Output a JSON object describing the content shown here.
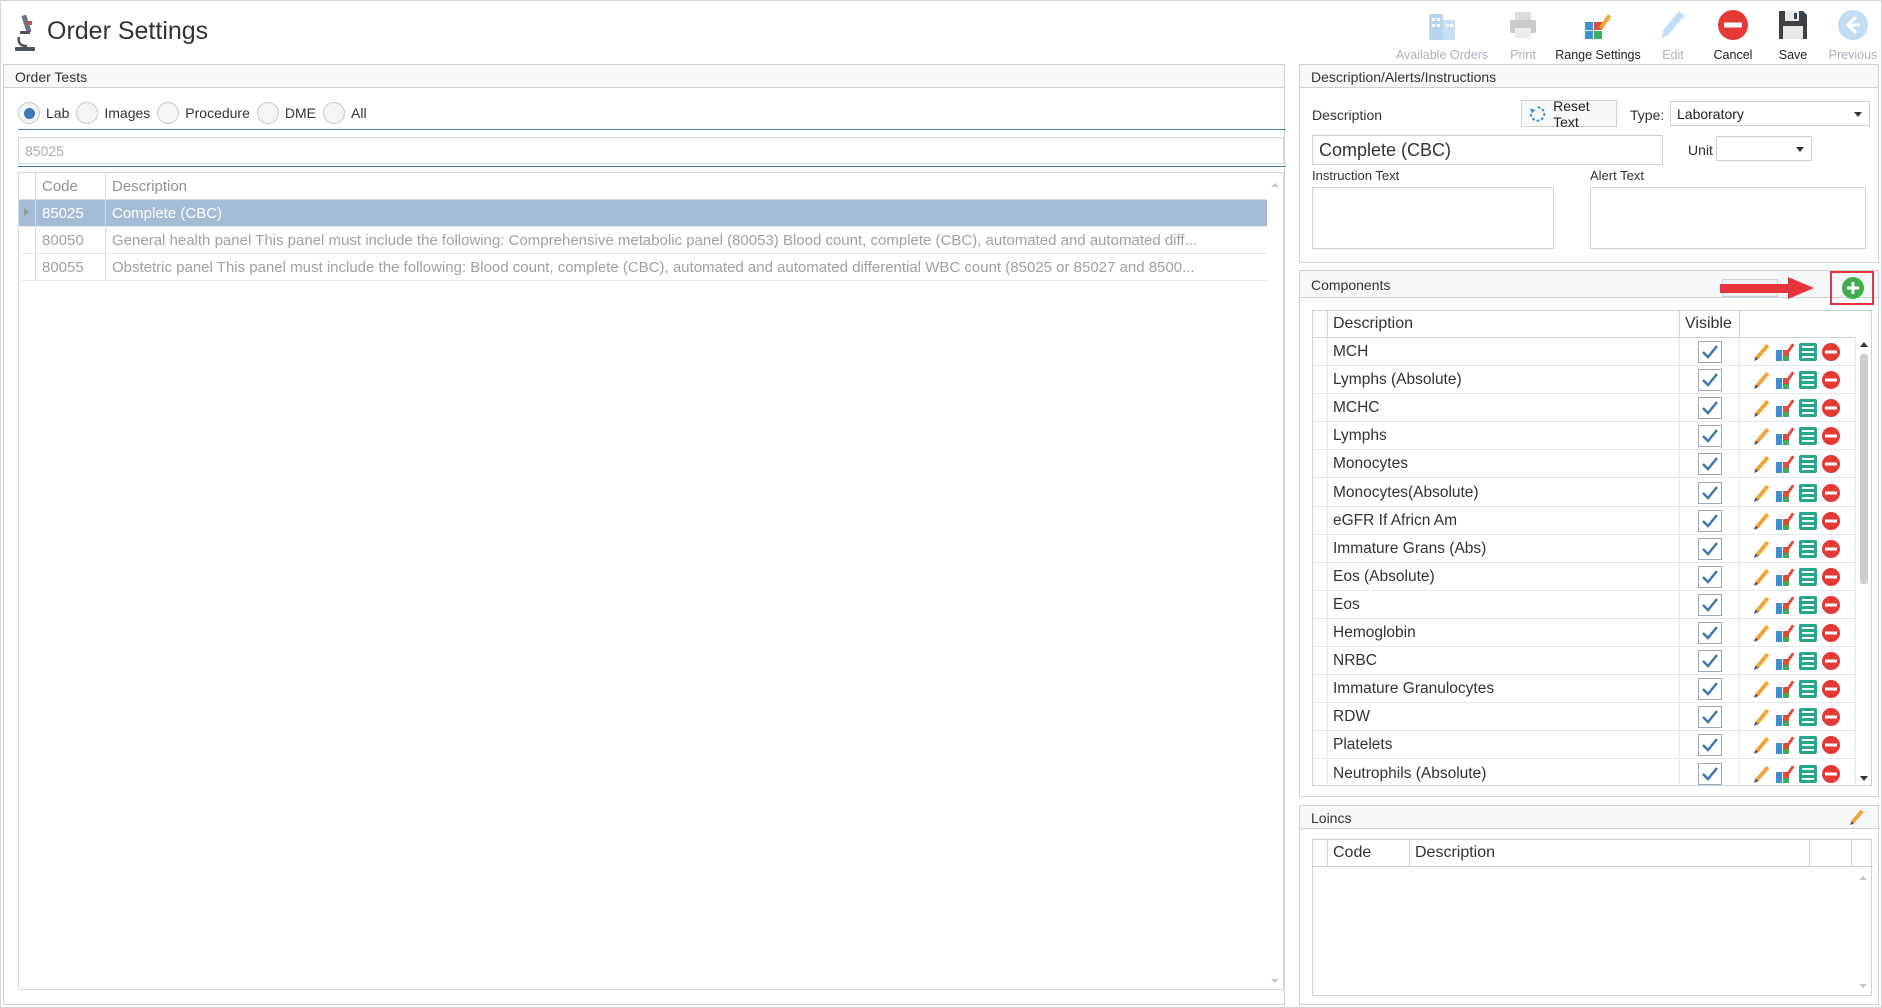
{
  "header": {
    "title": "Order Settings"
  },
  "toolbar": {
    "available_orders": "Available Orders",
    "print": "Print",
    "range_settings": "Range Settings",
    "edit": "Edit",
    "cancel": "Cancel",
    "save": "Save",
    "previous": "Previous"
  },
  "order_tests": {
    "header": "Order Tests",
    "radios": [
      {
        "label": "Lab",
        "checked": true
      },
      {
        "label": "Images",
        "checked": false
      },
      {
        "label": "Procedure",
        "checked": false
      },
      {
        "label": "DME",
        "checked": false
      },
      {
        "label": "All",
        "checked": false
      }
    ],
    "search_value": "85025",
    "columns": {
      "code": "Code",
      "description": "Description"
    },
    "rows": [
      {
        "code": "85025",
        "description": "Complete (CBC)"
      },
      {
        "code": "80050",
        "description": "General health panel This panel must include the following: Comprehensive metabolic panel (80053) Blood count, complete (CBC), automated and automated diff..."
      },
      {
        "code": "80055",
        "description": "Obstetric panel This panel must include the following: Blood count, complete (CBC), automated and automated differential WBC count (85025 or 85027 and 8500..."
      }
    ]
  },
  "description_panel": {
    "header": "Description/Alerts/Instructions",
    "description_label": "Description",
    "reset_text": "Reset Text",
    "type_label": "Type:",
    "type_value": "Laboratory",
    "description_value": "Complete (CBC)",
    "unit_label": "Unit",
    "unit_value": "",
    "instruction_label": "Instruction Text",
    "alert_label": "Alert Text"
  },
  "components": {
    "header": "Components",
    "columns": {
      "description": "Description",
      "visible": "Visible"
    },
    "rows": [
      {
        "description": "MCH",
        "visible": true
      },
      {
        "description": "Lymphs (Absolute)",
        "visible": true
      },
      {
        "description": "MCHC",
        "visible": true
      },
      {
        "description": "Lymphs",
        "visible": true
      },
      {
        "description": "Monocytes",
        "visible": true
      },
      {
        "description": "Monocytes(Absolute)",
        "visible": true
      },
      {
        "description": "eGFR If Africn Am",
        "visible": true
      },
      {
        "description": "Immature Grans (Abs)",
        "visible": true
      },
      {
        "description": "Eos (Absolute)",
        "visible": true
      },
      {
        "description": "Eos",
        "visible": true
      },
      {
        "description": "Hemoglobin",
        "visible": true
      },
      {
        "description": "NRBC",
        "visible": true
      },
      {
        "description": "Immature Granulocytes",
        "visible": true
      },
      {
        "description": "RDW",
        "visible": true
      },
      {
        "description": "Platelets",
        "visible": true
      },
      {
        "description": "Neutrophils (Absolute)",
        "visible": true
      }
    ]
  },
  "loincs": {
    "header": "Loincs",
    "columns": {
      "code": "Code",
      "description": "Description"
    }
  },
  "colors": {
    "accent": "#3c78b4",
    "selected_row": "#a5bcd7",
    "add_button": "#3dae4b",
    "cancel_red": "#e53935",
    "highlight_red": "#e8323c"
  }
}
